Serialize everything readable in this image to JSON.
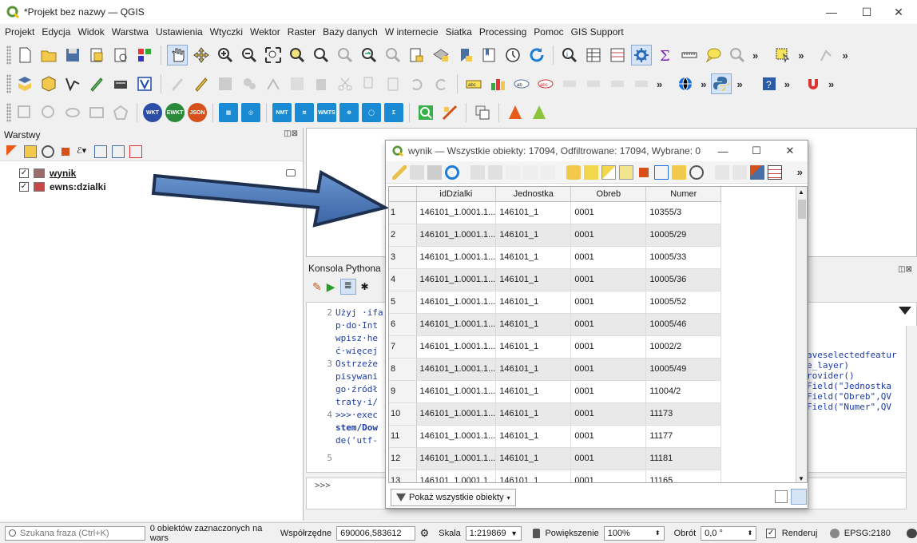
{
  "window": {
    "title": "*Projekt bez nazwy — QGIS",
    "minimize": "—",
    "maximize": "☐",
    "close": "✕"
  },
  "menu": [
    "Projekt",
    "Edycja",
    "Widok",
    "Warstwa",
    "Ustawienia",
    "Wtyczki",
    "Wektor",
    "Raster",
    "Bazy danych",
    "W internecie",
    "Siatka",
    "Processing",
    "Pomoc",
    "GIS Support"
  ],
  "toolbar3_badges": {
    "wkt": "WKT",
    "ewkt": "EWKT",
    "json": "JSON",
    "nmt": "NMT",
    "wmts": "WMTS"
  },
  "more": "»",
  "layers_panel": {
    "title": "Warstwy",
    "items": [
      {
        "label": "wynik",
        "checked": "✓",
        "color": "#9c6a6a"
      },
      {
        "label": "ewns:dzialki",
        "checked": "✓",
        "color": "#c84848"
      }
    ],
    "float_btn": "◫⊠"
  },
  "python_console": {
    "title": "Konsola Pythona",
    "lines": [
      {
        "num": "2",
        "text": "Użyj ·ifa"
      },
      {
        "num": "",
        "text": "p·do·Int"
      },
      {
        "num": "",
        "text": "wpisz·he"
      },
      {
        "num": "",
        "text": "ć·więcej"
      },
      {
        "num": "3",
        "text": "Ostrzeże"
      },
      {
        "num": "",
        "text": "pisywani"
      },
      {
        "num": "",
        "text": "go·źródł"
      },
      {
        "num": "",
        "text": "traty·i/"
      },
      {
        "num": "4",
        "text": ">>>·exec"
      },
      {
        "num": "",
        "text": "stem/Dow"
      },
      {
        "num": "",
        "text": "de('utf-"
      },
      {
        "num": "5",
        "text": ""
      }
    ],
    "prompt": ">>>"
  },
  "right_code": [
    "aveselectedfeatur",
    "",
    "e_layer)",
    "rovider()",
    "Field(\"Jednostka",
    "Field(\"Obreb\",QV",
    "Field(\"Numer\",QV"
  ],
  "attribute_table": {
    "title": "wynik — Wszystkie obiekty: 17094, Odfiltrowane: 17094, Wybrane: 0",
    "columns": [
      "idDzialki",
      "Jednostka",
      "Obreb",
      "Numer"
    ],
    "rows": [
      {
        "n": "1",
        "idDzialki": "146101_1.0001.1...",
        "Jednostka": "146101_1",
        "Obreb": "0001",
        "Numer": "10355/3"
      },
      {
        "n": "2",
        "idDzialki": "146101_1.0001.1...",
        "Jednostka": "146101_1",
        "Obreb": "0001",
        "Numer": "10005/29"
      },
      {
        "n": "3",
        "idDzialki": "146101_1.0001.1...",
        "Jednostka": "146101_1",
        "Obreb": "0001",
        "Numer": "10005/33"
      },
      {
        "n": "4",
        "idDzialki": "146101_1.0001.1...",
        "Jednostka": "146101_1",
        "Obreb": "0001",
        "Numer": "10005/36"
      },
      {
        "n": "5",
        "idDzialki": "146101_1.0001.1...",
        "Jednostka": "146101_1",
        "Obreb": "0001",
        "Numer": "10005/52"
      },
      {
        "n": "6",
        "idDzialki": "146101_1.0001.1...",
        "Jednostka": "146101_1",
        "Obreb": "0001",
        "Numer": "10005/46"
      },
      {
        "n": "7",
        "idDzialki": "146101_1.0001.1...",
        "Jednostka": "146101_1",
        "Obreb": "0001",
        "Numer": "10002/2"
      },
      {
        "n": "8",
        "idDzialki": "146101_1.0001.1...",
        "Jednostka": "146101_1",
        "Obreb": "0001",
        "Numer": "10005/49"
      },
      {
        "n": "9",
        "idDzialki": "146101_1.0001.1...",
        "Jednostka": "146101_1",
        "Obreb": "0001",
        "Numer": "11004/2"
      },
      {
        "n": "10",
        "idDzialki": "146101_1.0001.1...",
        "Jednostka": "146101_1",
        "Obreb": "0001",
        "Numer": "11173"
      },
      {
        "n": "11",
        "idDzialki": "146101_1.0001.1...",
        "Jednostka": "146101_1",
        "Obreb": "0001",
        "Numer": "11177"
      },
      {
        "n": "12",
        "idDzialki": "146101_1.0001.1...",
        "Jednostka": "146101_1",
        "Obreb": "0001",
        "Numer": "11181"
      },
      {
        "n": "13",
        "idDzialki": "146101_1.0001.1...",
        "Jednostka": "146101_1",
        "Obreb": "0001",
        "Numer": "11165"
      }
    ],
    "footer_button": "Pokaż wszystkie obiekty"
  },
  "status": {
    "search_placeholder": "Szukana fraza (Ctrl+K)",
    "selected_text": "0 obiektów zaznaczonych na wars",
    "coord_label": "Współrzędne",
    "coord_value": "690006,583612",
    "scale_label": "Skala",
    "scale_value": "1:219869",
    "zoom_label": "Powiększenie",
    "zoom_value": "100%",
    "rotation_label": "Obrót",
    "rotation_value": "0,0 °",
    "render_label": "Renderuj",
    "render_checked": "✓",
    "crs": "EPSG:2180"
  }
}
